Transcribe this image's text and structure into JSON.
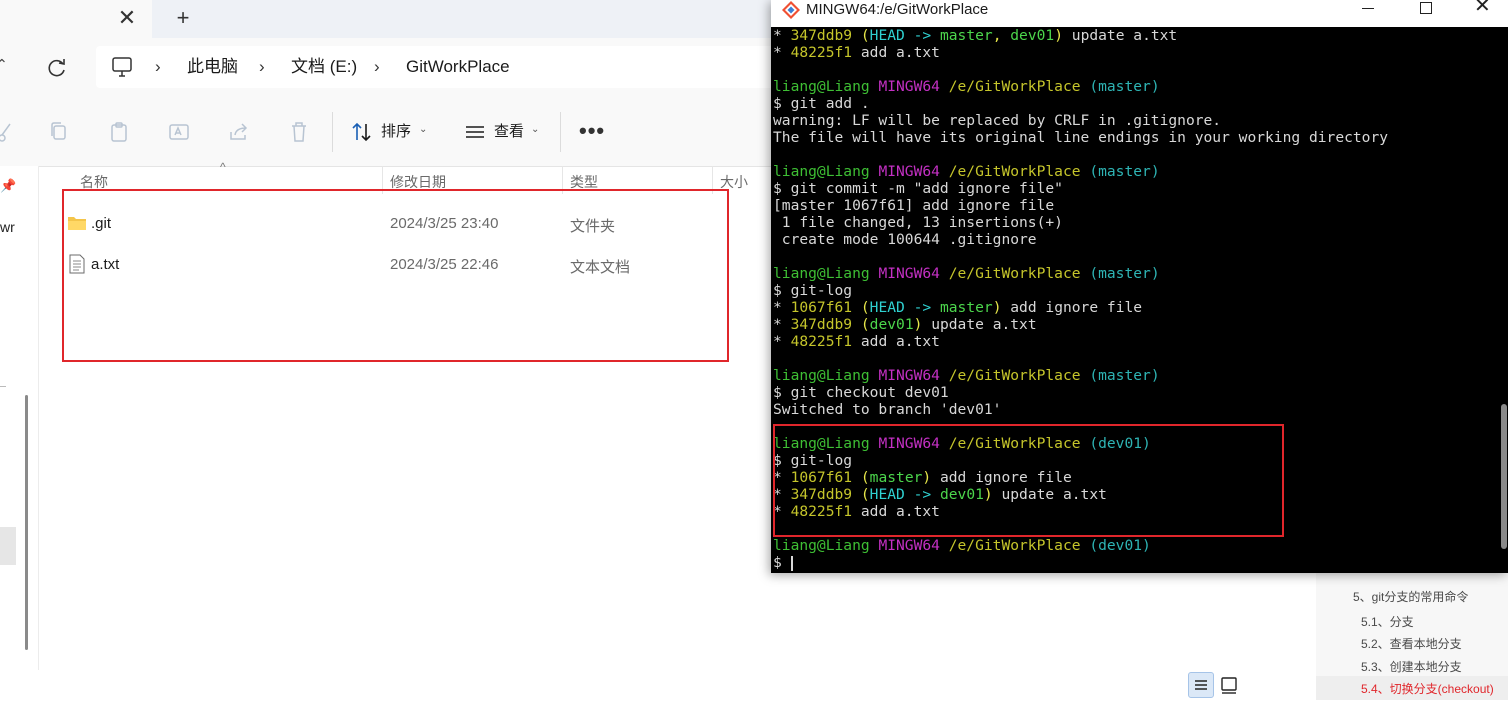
{
  "explorer": {
    "tab_close": "✕",
    "tab_new": "+",
    "breadcrumb": [
      "此电脑",
      "文档 (E:)",
      "GitWorkPlace"
    ],
    "toolbar": {
      "sort_label": "排序",
      "view_label": "查看",
      "more": "•••"
    },
    "columns": {
      "name": "名称",
      "modified": "修改日期",
      "type": "类型",
      "size": "大小"
    },
    "files": [
      {
        "name": ".git",
        "modified": "2024/3/25 23:40",
        "type": "文件夹",
        "icon": "folder-icon"
      },
      {
        "name": "a.txt",
        "modified": "2024/3/25 22:46",
        "type": "文本文档",
        "icon": "text-file-icon"
      }
    ],
    "nav_cut_text": "wr"
  },
  "terminal": {
    "title": "MINGW64:/e/GitWorkPlace",
    "lines": [
      [
        [
          "* ",
          "c-w"
        ],
        [
          "347ddb9 ",
          "c-y"
        ],
        [
          "(",
          "c-yb"
        ],
        [
          "HEAD -> ",
          "c-cb"
        ],
        [
          "master",
          "c-gb"
        ],
        [
          ", ",
          "c-yb"
        ],
        [
          "dev01",
          "c-gb"
        ],
        [
          ") ",
          "c-yb"
        ],
        [
          "update a.txt",
          "c-w"
        ]
      ],
      [
        [
          "* ",
          "c-w"
        ],
        [
          "48225f1 ",
          "c-y"
        ],
        [
          "add a.txt",
          "c-w"
        ]
      ],
      [],
      [
        [
          "liang@Liang ",
          "c-g"
        ],
        [
          "MINGW64 ",
          "c-m"
        ],
        [
          "/e/GitWorkPlace ",
          "c-y"
        ],
        [
          "(master)",
          "c-c"
        ]
      ],
      [
        [
          "$ git add .",
          "c-w"
        ]
      ],
      [
        [
          "warning: LF will be replaced by CRLF in .gitignore.",
          "c-w"
        ]
      ],
      [
        [
          "The file will have its original line endings in your working directory",
          "c-w"
        ]
      ],
      [],
      [
        [
          "liang@Liang ",
          "c-g"
        ],
        [
          "MINGW64 ",
          "c-m"
        ],
        [
          "/e/GitWorkPlace ",
          "c-y"
        ],
        [
          "(master)",
          "c-c"
        ]
      ],
      [
        [
          "$ git commit -m \"add ignore file\"",
          "c-w"
        ]
      ],
      [
        [
          "[master 1067f61] add ignore file",
          "c-w"
        ]
      ],
      [
        [
          " 1 file changed, 13 insertions(+)",
          "c-w"
        ]
      ],
      [
        [
          " create mode 100644 .gitignore",
          "c-w"
        ]
      ],
      [],
      [
        [
          "liang@Liang ",
          "c-g"
        ],
        [
          "MINGW64 ",
          "c-m"
        ],
        [
          "/e/GitWorkPlace ",
          "c-y"
        ],
        [
          "(master)",
          "c-c"
        ]
      ],
      [
        [
          "$ git-log",
          "c-w"
        ]
      ],
      [
        [
          "* ",
          "c-w"
        ],
        [
          "1067f61 ",
          "c-y"
        ],
        [
          "(",
          "c-yb"
        ],
        [
          "HEAD -> ",
          "c-cb"
        ],
        [
          "master",
          "c-gb"
        ],
        [
          ") ",
          "c-yb"
        ],
        [
          "add ignore file",
          "c-w"
        ]
      ],
      [
        [
          "* ",
          "c-w"
        ],
        [
          "347ddb9 ",
          "c-y"
        ],
        [
          "(",
          "c-yb"
        ],
        [
          "dev01",
          "c-gb"
        ],
        [
          ") ",
          "c-yb"
        ],
        [
          "update a.txt",
          "c-w"
        ]
      ],
      [
        [
          "* ",
          "c-w"
        ],
        [
          "48225f1 ",
          "c-y"
        ],
        [
          "add a.txt",
          "c-w"
        ]
      ],
      [],
      [
        [
          "liang@Liang ",
          "c-g"
        ],
        [
          "MINGW64 ",
          "c-m"
        ],
        [
          "/e/GitWorkPlace ",
          "c-y"
        ],
        [
          "(master)",
          "c-c"
        ]
      ],
      [
        [
          "$ git checkout dev01",
          "c-w"
        ]
      ],
      [
        [
          "Switched to branch 'dev01'",
          "c-w"
        ]
      ],
      [],
      [
        [
          "liang@Liang ",
          "c-g"
        ],
        [
          "MINGW64 ",
          "c-m"
        ],
        [
          "/e/GitWorkPlace ",
          "c-y"
        ],
        [
          "(dev01)",
          "c-c"
        ]
      ],
      [
        [
          "$ git-log",
          "c-w"
        ]
      ],
      [
        [
          "* ",
          "c-w"
        ],
        [
          "1067f61 ",
          "c-y"
        ],
        [
          "(",
          "c-yb"
        ],
        [
          "master",
          "c-gb"
        ],
        [
          ") ",
          "c-yb"
        ],
        [
          "add ignore file",
          "c-w"
        ]
      ],
      [
        [
          "* ",
          "c-w"
        ],
        [
          "347ddb9 ",
          "c-y"
        ],
        [
          "(",
          "c-yb"
        ],
        [
          "HEAD -> ",
          "c-cb"
        ],
        [
          "dev01",
          "c-gb"
        ],
        [
          ") ",
          "c-yb"
        ],
        [
          "update a.txt",
          "c-w"
        ]
      ],
      [
        [
          "* ",
          "c-w"
        ],
        [
          "48225f1 ",
          "c-y"
        ],
        [
          "add a.txt",
          "c-w"
        ]
      ],
      [],
      [
        [
          "liang@Liang ",
          "c-g"
        ],
        [
          "MINGW64 ",
          "c-m"
        ],
        [
          "/e/GitWorkPlace ",
          "c-y"
        ],
        [
          "(dev01)",
          "c-c"
        ]
      ],
      [
        [
          "$ ",
          "c-w"
        ]
      ]
    ]
  },
  "toc": {
    "items": [
      {
        "text": "5、git分支的常用命令",
        "active": false
      },
      {
        "text": "5.1、分支",
        "active": false
      },
      {
        "text": "5.2、查看本地分支",
        "active": false
      },
      {
        "text": "5.3、创建本地分支",
        "active": false
      },
      {
        "text": "5.4、切换分支(checkout)",
        "active": true
      }
    ]
  },
  "colors": {
    "highlight_box": "#e0262b",
    "terminal_bg": "#000000",
    "prompt_user": "#3ebf34",
    "prompt_host": "#c330c3",
    "prompt_path": "#c5c52b",
    "prompt_branch": "#2eb4b4"
  }
}
